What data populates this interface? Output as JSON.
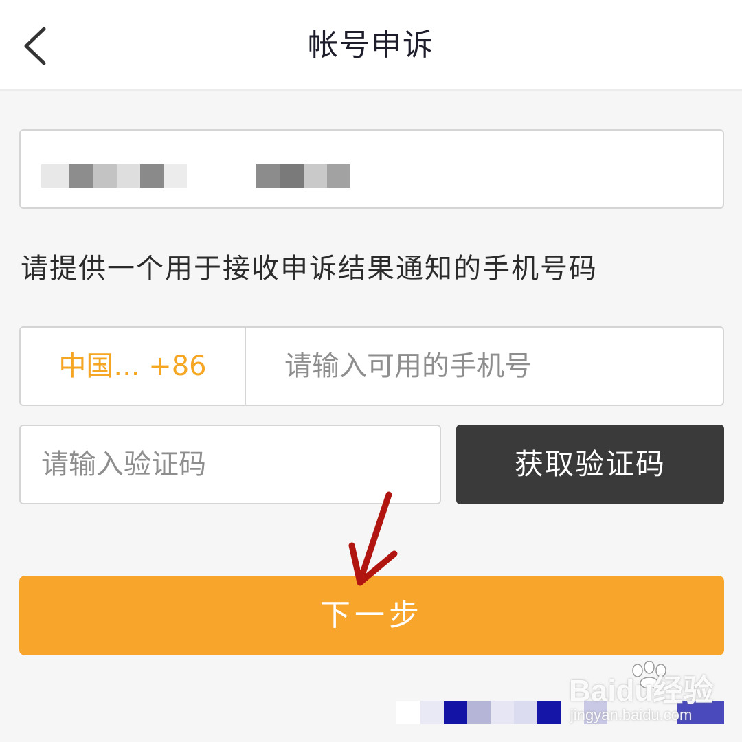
{
  "nav": {
    "title": "帐号申诉",
    "back_icon": "chevron-left-icon"
  },
  "account_field": {
    "value_redacted": true
  },
  "form": {
    "prompt": "请提供一个用于接收申诉结果通知的手机号码",
    "country_code_label": "中国... +86",
    "phone_placeholder": "请输入可用的手机号",
    "code_placeholder": "请输入验证码",
    "get_code_label": "获取验证码",
    "next_label": "下一步"
  },
  "annotation": {
    "arrow_icon": "red-arrow-pointer-icon"
  },
  "watermark": {
    "logo": "Baidu经验",
    "domain": "jingyan.baidu.com"
  },
  "colors": {
    "accent_orange": "#f8a52c",
    "country_code_orange": "#f5a623",
    "dark_button": "#3a3a3a",
    "arrow_red": "#b1150f",
    "page_background": "#f6f6f6"
  }
}
